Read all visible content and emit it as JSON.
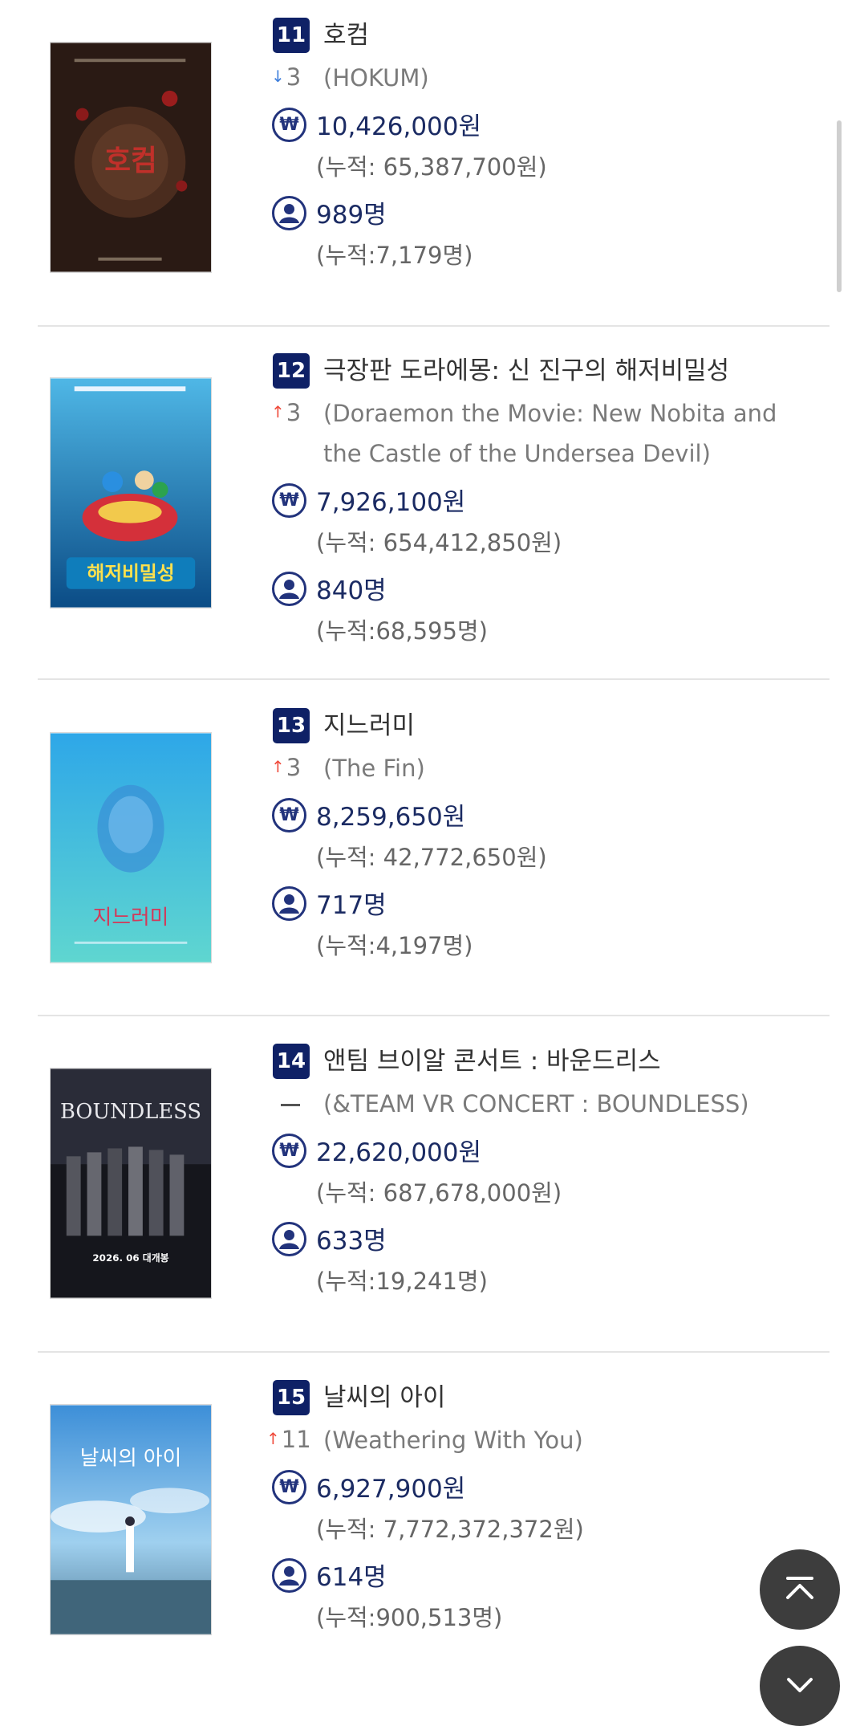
{
  "movies": [
    {
      "rank": "11",
      "title_ko": "호컴",
      "rank_change": "3",
      "change_direction": "down",
      "title_en": "(HOKUM)",
      "revenue": "10,426,000원",
      "revenue_cumulative": "(누적: 65,387,700원)",
      "audience": "989명",
      "audience_cumulative": "(누적:7,179명)",
      "poster_text": "호컴"
    },
    {
      "rank": "12",
      "title_ko": "극장판 도라에몽: 신 진구의 해저비밀성",
      "rank_change": "3",
      "change_direction": "up",
      "title_en": "(Doraemon the Movie: New Nobita and the Castle of the Undersea Devil)",
      "revenue": "7,926,100원",
      "revenue_cumulative": "(누적: 654,412,850원)",
      "audience": "840명",
      "audience_cumulative": "(누적:68,595명)",
      "poster_text": "해저비밀성"
    },
    {
      "rank": "13",
      "title_ko": "지느러미",
      "rank_change": "3",
      "change_direction": "up",
      "title_en": "(The Fin)",
      "revenue": "8,259,650원",
      "revenue_cumulative": "(누적: 42,772,650원)",
      "audience": "717명",
      "audience_cumulative": "(누적:4,197명)",
      "poster_text": "지느러미"
    },
    {
      "rank": "14",
      "title_ko": "앤팀 브이알 콘서트 : 바운드리스",
      "rank_change": "",
      "change_direction": "none",
      "title_en": "(&TEAM VR CONCERT : BOUNDLESS)",
      "revenue": "22,620,000원",
      "revenue_cumulative": "(누적: 687,678,000원)",
      "audience": "633명",
      "audience_cumulative": "(누적:19,241명)",
      "poster_text": "BOUNDLESS",
      "poster_subtext": "2026. 06 대개봉"
    },
    {
      "rank": "15",
      "title_ko": "날씨의 아이",
      "rank_change": "11",
      "change_direction": "up",
      "title_en": "(Weathering With You)",
      "revenue": "6,927,900원",
      "revenue_cumulative": "(누적: 7,772,372,372원)",
      "audience": "614명",
      "audience_cumulative": "(누적:900,513명)",
      "poster_text": "날씨의 아이"
    }
  ],
  "icons": {
    "won": "₩",
    "up_arrow": "↑",
    "down_arrow": "↓"
  },
  "colors": {
    "badge": "#0f2166",
    "up": "#ef4b3c",
    "down": "#3f7fdc",
    "fab": "#3d3d3d"
  }
}
